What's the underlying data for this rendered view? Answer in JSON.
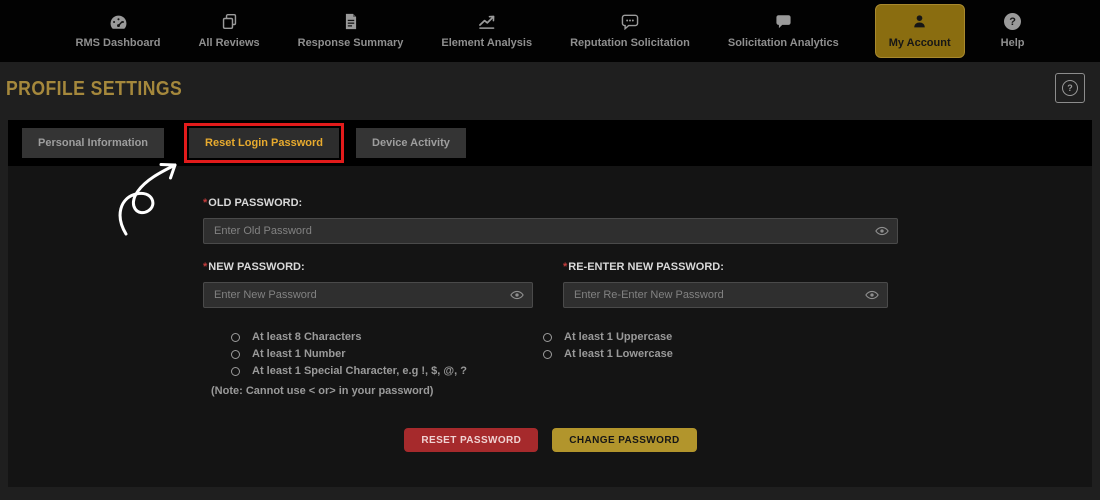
{
  "nav": {
    "items": [
      {
        "label": "RMS Dashboard",
        "icon": "gauge-icon"
      },
      {
        "label": "All Reviews",
        "icon": "copy-icon"
      },
      {
        "label": "Response Summary",
        "icon": "document-icon"
      },
      {
        "label": "Element Analysis",
        "icon": "line-chart-icon"
      },
      {
        "label": "Reputation Solicitation",
        "icon": "chat-dots-icon"
      },
      {
        "label": "Solicitation Analytics",
        "icon": "chat-icon"
      },
      {
        "label": "My Account",
        "icon": "user-icon",
        "active": true
      },
      {
        "label": "Help",
        "icon": "help-icon"
      }
    ]
  },
  "header": {
    "title": "PROFILE SETTINGS"
  },
  "tabs": [
    {
      "label": "Personal Information"
    },
    {
      "label": "Reset Login Password",
      "highlighted": true
    },
    {
      "label": "Device Activity"
    }
  ],
  "form": {
    "required_marker": "*",
    "old_password": {
      "label": "OLD PASSWORD:",
      "placeholder": "Enter Old Password"
    },
    "new_password": {
      "label": "NEW PASSWORD:",
      "placeholder": "Enter New Password"
    },
    "reenter_password": {
      "label": "RE-ENTER NEW PASSWORD:",
      "placeholder": "Enter Re-Enter New Password"
    },
    "requirements_left": [
      "At least 8 Characters",
      "At least 1 Number",
      "At least 1 Special Character, e.g !, $, @, ?"
    ],
    "requirements_right": [
      "At least 1 Uppercase",
      "At least 1 Lowercase"
    ],
    "note": "(Note: Cannot use < or> in your password)",
    "reset_button": "RESET PASSWORD",
    "change_button": "CHANGE PASSWORD"
  },
  "colors": {
    "accent_gold": "#b2952c",
    "active_nav_gold": "#8a6d10",
    "danger_red": "#a62a2c",
    "annotation_red": "#e21b1b",
    "title_gold": "#a5883c"
  }
}
